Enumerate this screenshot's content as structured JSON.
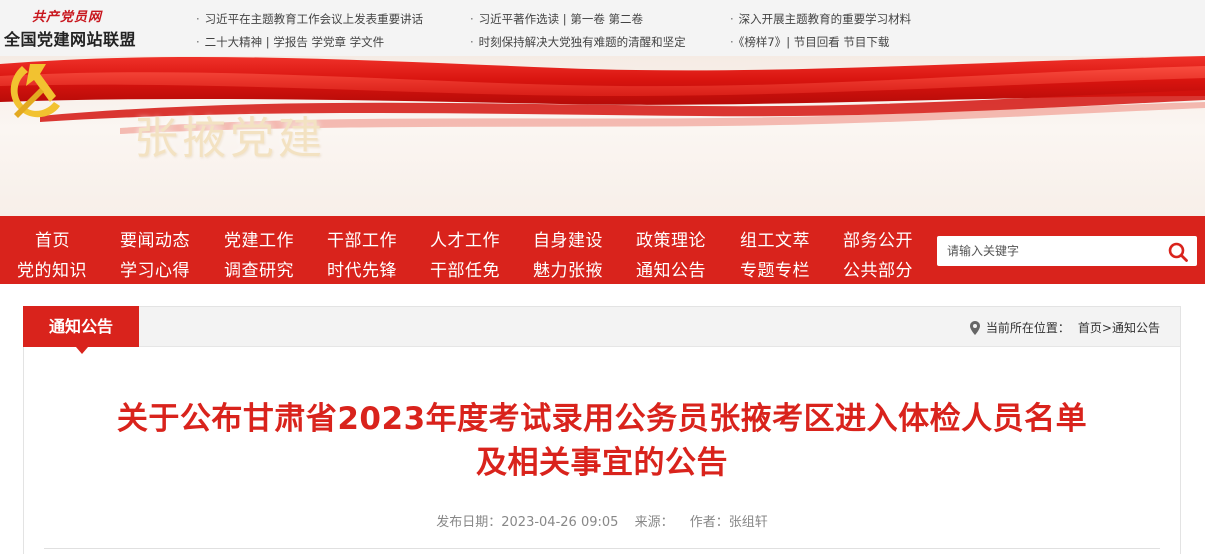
{
  "header": {
    "logo_script": "共产党员网",
    "logo_main": "全国党建网站联盟",
    "links": [
      "习近平在主题教育工作会议上发表重要讲话",
      "习近平著作选读 | 第一卷  第二卷",
      "深入开展主题教育的重要学习材料",
      "二十大精神 | 学报告  学党章  学文件",
      "时刻保持解决大党独有难题的清醒和坚定",
      "《榜样7》| 节目回看    节目下载"
    ]
  },
  "banner": {
    "title": "张掖党建"
  },
  "nav": {
    "row1": [
      "首页",
      "要闻动态",
      "党建工作",
      "干部工作",
      "人才工作",
      "自身建设",
      "政策理论",
      "组工文萃",
      "部务公开"
    ],
    "row2": [
      "党的知识",
      "学习心得",
      "调查研究",
      "时代先锋",
      "干部任免",
      "魅力张掖",
      "通知公告",
      "专题专栏",
      "公共部分"
    ]
  },
  "search": {
    "placeholder": "请输入关键字"
  },
  "section": {
    "tag": "通知公告",
    "location_label": "当前所在位置：",
    "crumb_home": "首页",
    "crumb_sep": ">",
    "crumb_current": "通知公告"
  },
  "article": {
    "title_line1": "关于公布甘肃省2023年度考试录用公务员张掖考区进入体检人员名单",
    "title_line2": "及相关事宜的公告",
    "date": "发布日期：2023-04-26 09:05",
    "source": "来源：",
    "author": "作者：张组轩"
  },
  "colors": {
    "brand_red": "#d9231c",
    "gold": "#f2c230"
  }
}
